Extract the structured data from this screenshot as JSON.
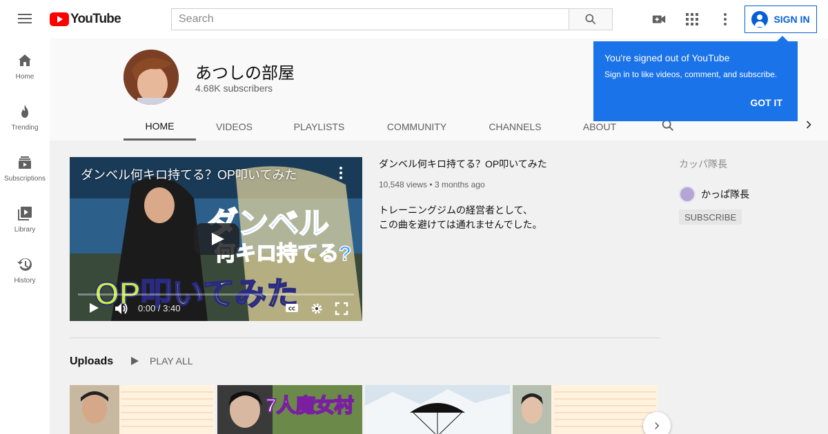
{
  "topbar": {
    "logo_text": "YouTube",
    "search_placeholder": "Search",
    "sign_in_label": "SIGN IN"
  },
  "sidebar": {
    "items": [
      {
        "label": "Home",
        "icon": "home-icon"
      },
      {
        "label": "Trending",
        "icon": "fire-icon"
      },
      {
        "label": "Subscriptions",
        "icon": "subscriptions-icon"
      },
      {
        "label": "Library",
        "icon": "library-icon"
      },
      {
        "label": "History",
        "icon": "history-icon"
      }
    ]
  },
  "channel": {
    "name": "あつしの部屋",
    "subscribers": "4.68K subscribers"
  },
  "tabs": [
    "HOME",
    "VIDEOS",
    "PLAYLISTS",
    "COMMUNITY",
    "CHANNELS",
    "ABOUT"
  ],
  "featured": {
    "player_title": "ダンベル何キロ持てる？OP叩いてみた",
    "time": "0:00 / 3:40",
    "title": "ダンベル何キロ持てる？OP叩いてみた",
    "views": "10,548 views",
    "age": "3 months ago",
    "desc_line1": "トレーニングジムの経営者として、",
    "desc_line2": "この曲を避けては通れませんでした。",
    "art_text1": "ダンベル",
    "art_text2": "何キロ持てる?",
    "art_text3": "OP叩いてみた"
  },
  "uploads": {
    "title": "Uploads",
    "play_all": "PLAY ALL",
    "thumb2_text": "7人魔女村"
  },
  "related": {
    "header": "カッパ隊長",
    "channel_name": "かっぱ隊長",
    "subscribe_label": "SUBSCRIBE"
  },
  "popup": {
    "title": "You're signed out of YouTube",
    "text": "Sign in to like videos, comment, and subscribe.",
    "button": "GOT IT"
  },
  "colors": {
    "brand_red": "#ff0000",
    "accent_blue": "#065fd4",
    "popup_blue": "#1a73e8"
  }
}
